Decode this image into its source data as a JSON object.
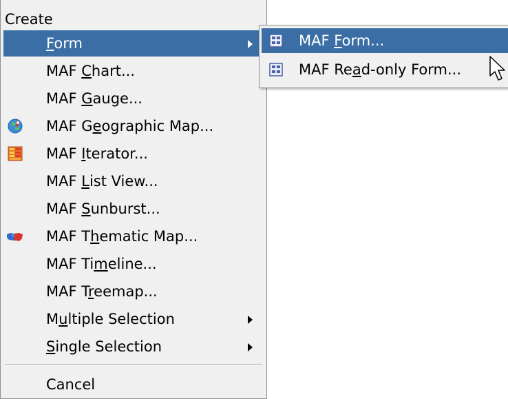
{
  "menu": {
    "header": "Create",
    "items": [
      {
        "name": "form",
        "pre": "",
        "ul": "F",
        "post": "orm",
        "icon": "",
        "submenu": true,
        "selected": true
      },
      {
        "name": "maf-chart",
        "pre": "MAF ",
        "ul": "C",
        "post": "hart...",
        "icon": "",
        "submenu": false,
        "selected": false
      },
      {
        "name": "maf-gauge",
        "pre": "MAF ",
        "ul": "G",
        "post": "auge...",
        "icon": "",
        "submenu": false,
        "selected": false
      },
      {
        "name": "maf-geographic-map",
        "pre": "MAF G",
        "ul": "e",
        "post": "ographic Map...",
        "icon": "globe-icon",
        "submenu": false,
        "selected": false
      },
      {
        "name": "maf-iterator",
        "pre": "MAF ",
        "ul": "I",
        "post": "terator...",
        "icon": "iterator-icon",
        "submenu": false,
        "selected": false
      },
      {
        "name": "maf-list-view",
        "pre": "MAF ",
        "ul": "L",
        "post": "ist View...",
        "icon": "",
        "submenu": false,
        "selected": false
      },
      {
        "name": "maf-sunburst",
        "pre": "MAF ",
        "ul": "S",
        "post": "unburst...",
        "icon": "",
        "submenu": false,
        "selected": false
      },
      {
        "name": "maf-thematic-map",
        "pre": "MAF T",
        "ul": "h",
        "post": "ematic Map...",
        "icon": "thematic-map-icon",
        "submenu": false,
        "selected": false
      },
      {
        "name": "maf-timeline",
        "pre": "MAF Ti",
        "ul": "m",
        "post": "eline...",
        "icon": "",
        "submenu": false,
        "selected": false
      },
      {
        "name": "maf-treemap",
        "pre": "MAF T",
        "ul": "r",
        "post": "eemap...",
        "icon": "",
        "submenu": false,
        "selected": false
      },
      {
        "name": "multiple-selection",
        "pre": "M",
        "ul": "u",
        "post": "ltiple Selection",
        "icon": "",
        "submenu": true,
        "selected": false
      },
      {
        "name": "single-selection",
        "pre": "",
        "ul": "S",
        "post": "ingle Selection",
        "icon": "",
        "submenu": true,
        "selected": false
      }
    ],
    "cancel": "Cancel"
  },
  "submenu": {
    "items": [
      {
        "name": "maf-form",
        "pre": "MAF ",
        "ul": "F",
        "post": "orm...",
        "icon": "form-icon",
        "selected": true
      },
      {
        "name": "maf-read-only-form",
        "pre": "MAF Re",
        "ul": "a",
        "post": "d-only Form...",
        "icon": "form-icon",
        "selected": false
      }
    ]
  },
  "colors": {
    "menu_bg": "#f0f0f0",
    "selection": "#3a6ea5",
    "border": "#8f8f8f"
  }
}
